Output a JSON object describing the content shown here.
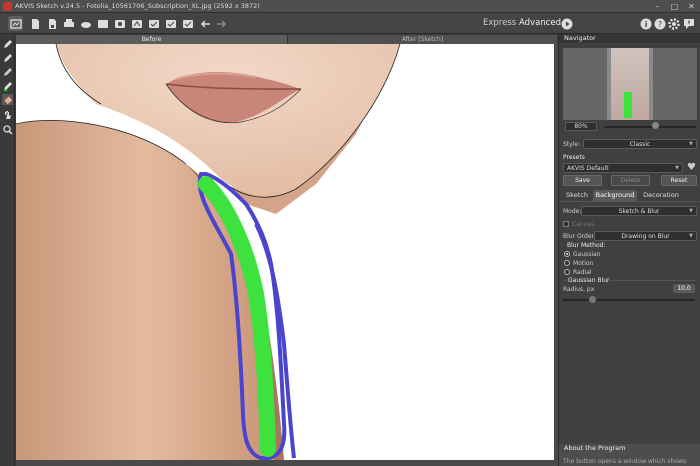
{
  "app": {
    "title": "AKVIS Sketch v.24.5 - Fotolia_10561706_Subscription_XL.jpg (2592 x 3872)",
    "window_controls": [
      "minimize-icon",
      "maximize-icon",
      "close-icon"
    ]
  },
  "toolbar": {
    "icons": [
      "home-icon",
      "open-icon",
      "save-icon",
      "print-icon",
      "share-icon",
      "batch-icon",
      "settings-icon",
      "sketch-icon",
      "background-icon",
      "check-icon",
      "edit-icon",
      "brush-check-icon",
      "undo-arrow-icon",
      "redo-arrow-icon"
    ],
    "mode_express": "Express",
    "mode_advanced": "Advanced",
    "right_icons": [
      "run-icon",
      "info-icon",
      "help-icon",
      "gear-icon",
      "notification-icon"
    ]
  },
  "left_tools": [
    "pencil-icon",
    "eraser-icon",
    "tube-icon",
    "bucket-icon",
    "erase-icon",
    "hand-icon",
    "zoom-icon"
  ],
  "view_tabs": {
    "before": "Before",
    "after": "After [Sketch]"
  },
  "navigator": {
    "title": "Navigator",
    "zoom": "80%",
    "zoom_level": 0.55
  },
  "settings": {
    "style_label": "Style:",
    "style_value": "Classic",
    "presets_label": "Presets",
    "preset_value": "AKVIS Default",
    "save": "Save",
    "delete": "Delete",
    "reset": "Reset",
    "tabs": [
      "Sketch",
      "Background",
      "Decoration"
    ],
    "mode_label": "Mode:",
    "mode_value": "Sketch & Blur",
    "canvas_check": "Canvas",
    "blur_order_label": "Blur Order:",
    "blur_order_value": "Drawing on Blur",
    "blur_method_label": "Blur Method:",
    "methods": [
      "Gaussian",
      "Motion",
      "Radial"
    ],
    "gaussian_header": "Gaussian Blur",
    "radius_label": "Radius, px",
    "radius_value": "10,0"
  },
  "about": {
    "title": "About the Program",
    "text": "The button opens a window which shows"
  }
}
